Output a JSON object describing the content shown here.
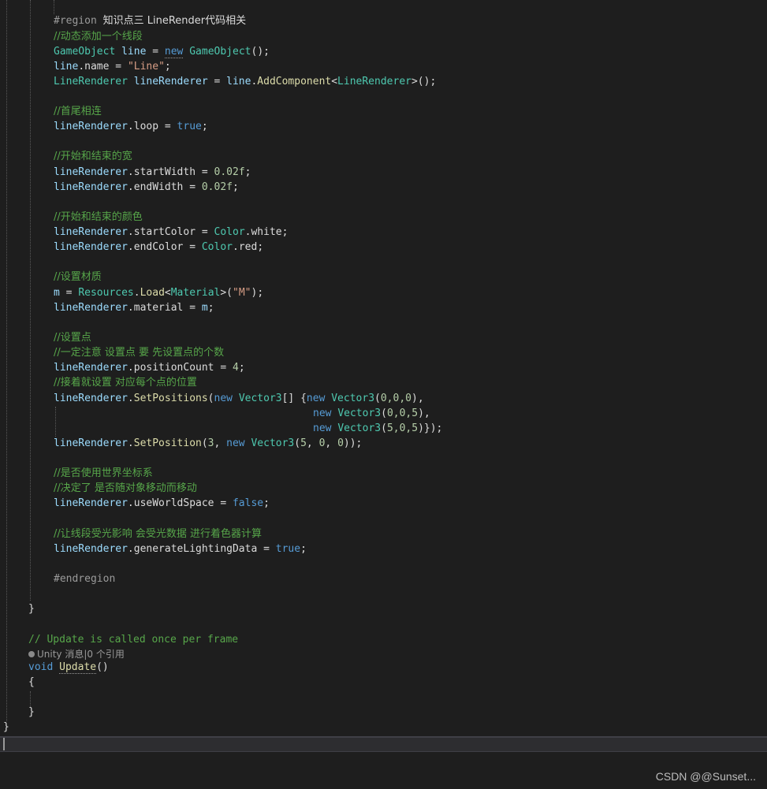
{
  "code": {
    "region_keyword": "#region",
    "region_title": "知识点三 LineRender代码相关",
    "c_add_line": "//动态添加一个线段",
    "c_loop": "//首尾相连",
    "c_width": "//开始和结束的宽",
    "c_color": "//开始和结束的颜色",
    "c_material": "//设置材质",
    "c_points": "//设置点",
    "c_note": "//一定注意 设置点 要 先设置点的个数",
    "c_set_each": "//接着就设置 对应每个点的位置",
    "c_world": "//是否使用世界坐标系",
    "c_world2": "//决定了 是否随对象移动而移动",
    "c_light": "//让线段受光影响 会受光数据 进行着色器计算",
    "endregion": "#endregion",
    "c_update": "// Update is called once per frame",
    "codelens": "Unity 消息|0 个引用",
    "t_gameobject": "GameObject",
    "t_linerenderer": "LineRenderer",
    "t_color": "Color",
    "t_resources": "Resources",
    "t_material": "Material",
    "t_vector3": "Vector3",
    "v_line": "line",
    "v_lineRenderer": "lineRenderer",
    "v_m": "m",
    "kw_new": "new",
    "kw_true": "true",
    "kw_false": "false",
    "kw_void": "void",
    "s_line": "\"Line\"",
    "s_m": "\"M\"",
    "p_name": "name",
    "p_loop": "loop",
    "p_startWidth": "startWidth",
    "p_endWidth": "endWidth",
    "p_startColor": "startColor",
    "p_endColor": "endColor",
    "p_material": "material",
    "p_positionCount": "positionCount",
    "p_useWorldSpace": "useWorldSpace",
    "p_generateLightingData": "generateLightingData",
    "p_white": "white",
    "p_red": "red",
    "m_AddComponent": "AddComponent",
    "m_Load": "Load",
    "m_SetPositions": "SetPositions",
    "m_SetPosition": "SetPosition",
    "m_Update": "Update",
    "n_002f": "0.02f",
    "n_4": "4",
    "n_3": "3",
    "vec_000": "0,0,0",
    "vec_005": "0,0,5",
    "vec_505": "5,0,5",
    "n_5": "5",
    "n_0": "0",
    "n_0b": "0"
  },
  "watermark": "CSDN @@Sunset..."
}
